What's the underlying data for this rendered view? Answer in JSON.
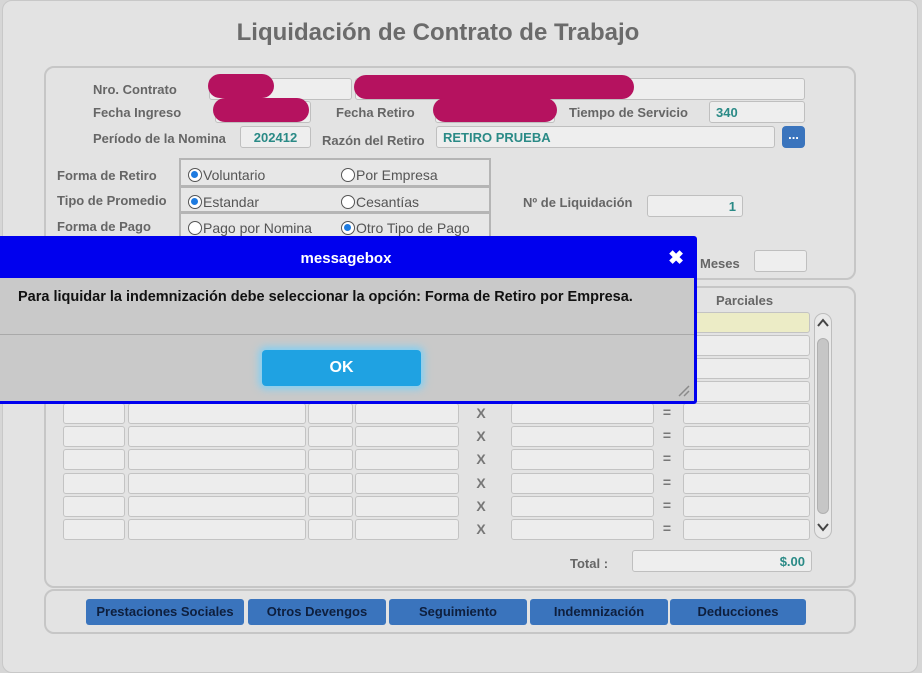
{
  "title": "Liquidación de Contrato de Trabajo",
  "header": {
    "nro_contrato_label": "Nro. Contrato",
    "fecha_ingreso_label": "Fecha Ingreso",
    "fecha_retiro_label": "Fecha  Retiro",
    "tiempo_servicio_label": "Tiempo de Servicio",
    "tiempo_servicio_value": "340",
    "periodo_label": "Período de la Nomina",
    "periodo_value": "202412",
    "razon_label": "Razón del Retiro",
    "razon_value": "RETIRO PRUEBA",
    "razon_button_label": "..."
  },
  "options": {
    "forma_retiro_label": "Forma de Retiro",
    "forma_retiro_options": [
      "Voluntario",
      "Por Empresa"
    ],
    "tipo_promedio_label": "Tipo de Promedio",
    "tipo_promedio_options": [
      "Estandar",
      "Cesantías"
    ],
    "forma_pago_label": "Forma de Pago",
    "forma_pago_options": [
      "Pago por Nomina",
      "Otro Tipo de Pago"
    ],
    "nro_liquidacion_label": "Nº de Liquidación",
    "nro_liquidacion_value": "1",
    "meses_label": "Meses"
  },
  "table": {
    "parciales_header": "Parciales",
    "multiply_symbol": "X",
    "equals_symbol": "=",
    "total_label": "Total :",
    "total_value": "$.00"
  },
  "tabs": [
    "Prestaciones Sociales",
    "Otros Devengos",
    "Seguimiento",
    "Indemnización",
    "Deducciones"
  ],
  "dialog": {
    "title": "messagebox",
    "close_label": "✖",
    "message": "Para liquidar la indemnización debe seleccionar la opción: Forma de Retiro por Empresa.",
    "ok_label": "OK"
  },
  "colors": {
    "accent": "#0000ee",
    "ok_button": "#1fa2e2",
    "tab_button": "#3a74bd",
    "value_text": "#2a8a86",
    "redaction": "#b5125f"
  }
}
